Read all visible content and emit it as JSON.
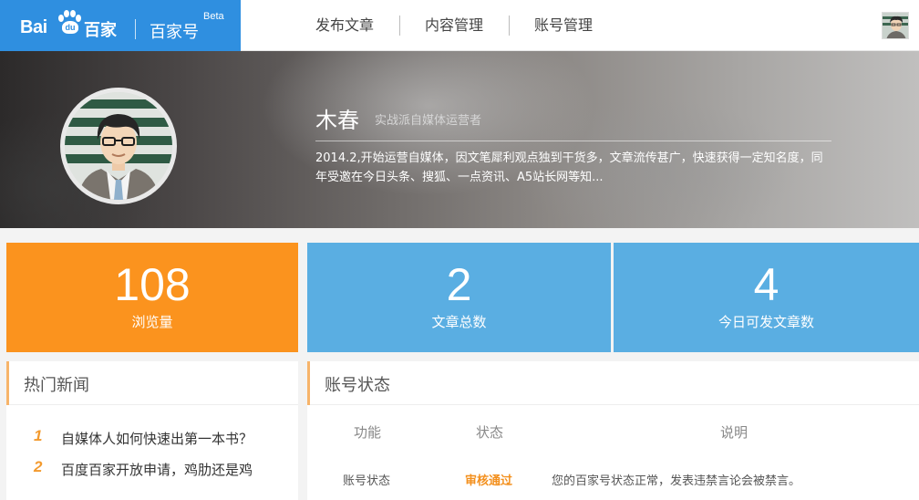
{
  "brand": {
    "logo_bai": "Bai",
    "logo_du": "du",
    "logo_baijia": "百家",
    "product_name": "百家号",
    "beta": "Beta",
    "accent_color": "#2f8fe0"
  },
  "nav": {
    "items": [
      {
        "label": "发布文章"
      },
      {
        "label": "内容管理"
      },
      {
        "label": "账号管理"
      }
    ]
  },
  "profile": {
    "name": "木春",
    "tag": "实战派自媒体运营者",
    "bio": "2014.2,开始运营自媒体，因文笔犀利观点独到干货多，文章流传甚广，快速获得一定知名度，同年受邀在今日头条、搜狐、一点资讯、A5站长网等知..."
  },
  "stats": [
    {
      "value": "108",
      "label": "浏览量",
      "color": "#fb931e"
    },
    {
      "value": "2",
      "label": "文章总数",
      "color": "#5aaee2"
    },
    {
      "value": "4",
      "label": "今日可发文章数",
      "color": "#5aaee2"
    }
  ],
  "hot_news": {
    "title": "热门新闻",
    "items": [
      {
        "rank": "1",
        "text": "自媒体人如何快速出第一本书？"
      },
      {
        "rank": "2",
        "text": "百度百家开放申请，鸡肋还是鸡"
      }
    ]
  },
  "account_status": {
    "title": "账号状态",
    "columns": [
      "功能",
      "状态",
      "说明"
    ],
    "rows": [
      {
        "function": "账号状态",
        "status": "审核通过",
        "note": "您的百家号状态正常，发表违禁言论会被禁言。",
        "status_color": "#f3901e"
      }
    ]
  }
}
